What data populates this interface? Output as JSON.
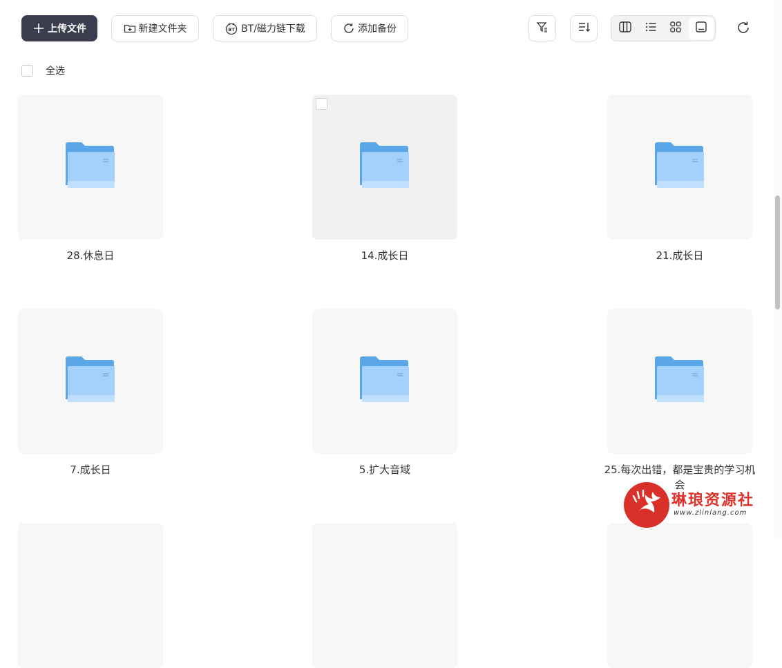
{
  "toolbar": {
    "upload_label": "上传文件",
    "new_folder_label": "新建文件夹",
    "bt_label": "BT/磁力链下载",
    "backup_label": "添加备份"
  },
  "select_all_label": "全选",
  "folders": [
    {
      "name": "28.休息日"
    },
    {
      "name": "14.成长日"
    },
    {
      "name": "21.成长日"
    },
    {
      "name": "7.成长日"
    },
    {
      "name": "5.扩大音域"
    },
    {
      "name": "25.每次出错，都是宝贵的学习机会"
    }
  ],
  "watermark": {
    "text": "琳琅资源社",
    "url": "www.zlinlang.com"
  },
  "colors": {
    "primary": "#3b3d4f",
    "folder": "#6cb3ee",
    "watermark": "#e0322b"
  }
}
